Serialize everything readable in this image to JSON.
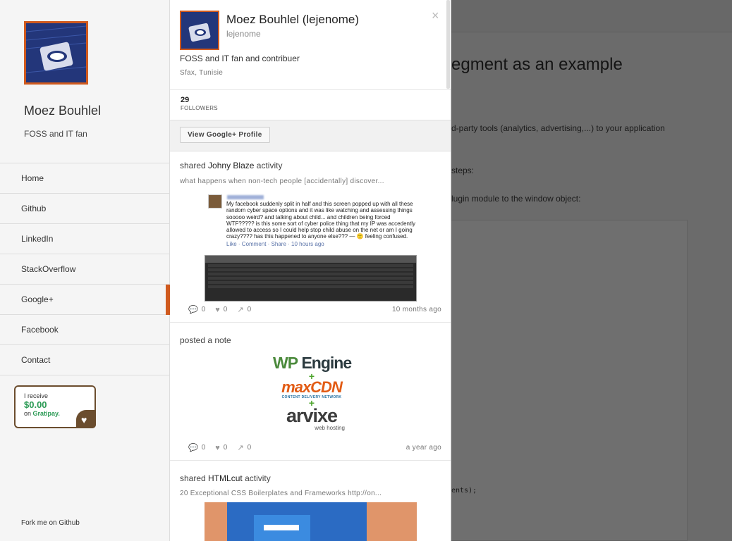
{
  "sidebar": {
    "name": "Moez Bouhlel",
    "tagline": "FOSS and IT fan",
    "nav": [
      "Home",
      "Github",
      "LinkedIn",
      "StackOverflow",
      "Google+",
      "Facebook",
      "Contact"
    ],
    "active_nav": "Google+",
    "gratipay": {
      "line1": "I receive",
      "amount": "$0.00",
      "line3_prefix": "on",
      "line3_brand": "Gratipay."
    },
    "fork": "Fork me on Github"
  },
  "blog": {
    "title_fragment": "egment as an example",
    "p1_fragment": "d-party tools (analytics, advertising,...) to your application",
    "p2_fragment": "steps:",
    "p3_fragment": "lugin module to the window object:",
    "code_fragment": "ents);"
  },
  "popup": {
    "name": "Moez Bouhlel (lejenome)",
    "handle": "lejenome",
    "close": "×",
    "bio": "FOSS and IT fan and contribuer",
    "location": "Sfax, Tunisie",
    "followers_count": "29",
    "followers_label": "FOLLOWERS",
    "view_button": "View Google+ Profile",
    "posts": [
      {
        "verb": "shared",
        "author": "Johny Blaze",
        "suffix": "activity",
        "subtitle": "what happens when non-tech people [accidentally] discover...",
        "embed_text": "My facebook suddenly split in half and this screen popped up with all these random cyber space options and it was like watching and assessing things sooooo weird? and talking about child... and children being forced WTF????? is this some sort of cyber police thing that my IP was accedently allowed to access so I could help stop child abuse on the net or am I going crazy???? has this happened to anyone else??? — 🙁 feeling confused.",
        "embed_links": "Like · Comment · Share · 10 hours ago",
        "comments": "0",
        "plusones": "0",
        "shares": "0",
        "time": "10 months ago"
      },
      {
        "verb": "posted a note",
        "logo_wp": "WP",
        "logo_engine": "Engine",
        "logo_maxcdn": "maxCDN",
        "logo_maxcdn_sub": "CONTENT DELIVERY NETWORK",
        "logo_arvixe": "arvixe",
        "logo_arvixe_sub": "web hosting",
        "comments": "0",
        "plusones": "0",
        "shares": "0",
        "time": "a year ago"
      },
      {
        "verb": "shared",
        "author": "HTMLcut",
        "suffix": "activity",
        "subtitle": "20 Exceptional CSS Boilerplates and Frameworks http://on..."
      }
    ]
  },
  "colors": {
    "accent": "#d05a1e",
    "gratipay_green": "#2a9a54",
    "overlay": "#6b6b6b"
  }
}
